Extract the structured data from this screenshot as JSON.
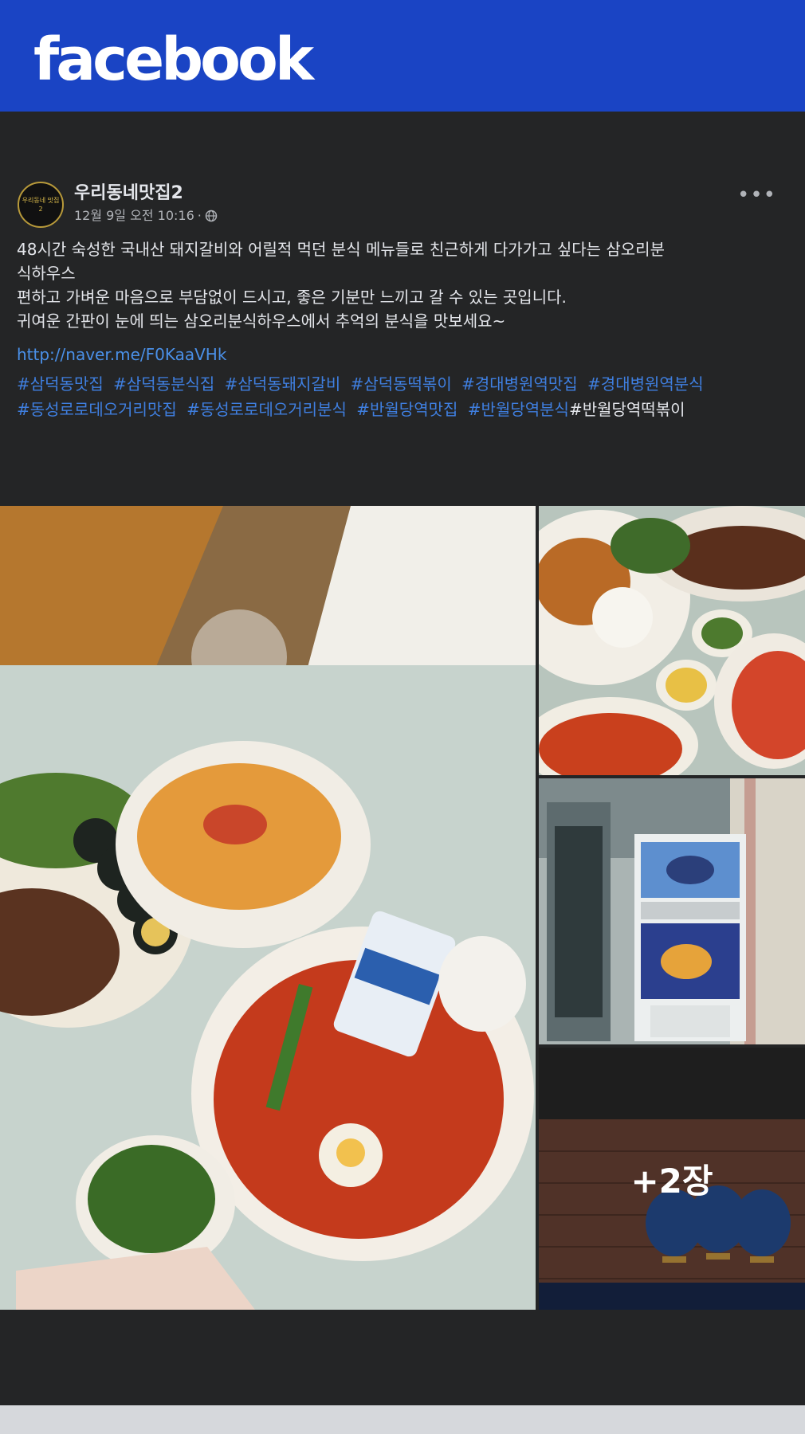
{
  "app": {
    "logo_text": "facebook",
    "brand_color": "#1a44c4"
  },
  "post": {
    "avatar_text": "우리동네 맛집 2",
    "page_name": "우리동네맛집2",
    "timestamp": "12월 9일 오전 10:16",
    "separator": "·",
    "privacy_icon": "globe-icon",
    "more_label": "•••",
    "body_lines": [
      "48시간 숙성한 국내산 돼지갈비와 어릴적 먹던 분식 메뉴들로 친근하게 다가가고 싶다는 삼오리분",
      "식하우스",
      "편하고 가벼운 마음으로 부담없이 드시고, 좋은 기분만 느끼고 갈 수 있는 곳입니다.",
      "귀여운 간판이 눈에 띄는 삼오리분식하우스에서 추억의 분식을 맛보세요~"
    ],
    "link": "http://naver.me/F0KaaVHk",
    "hashtags_row1": [
      "#삼덕동맛집",
      "#삼덕동분식집",
      "#삼덕동돼지갈비",
      "#삼덕동떡볶이",
      "#경대병원역맛집",
      "#경대병원역분식"
    ],
    "hashtags_row2": [
      "#동성로로데오거리맛집",
      "#동성로로데오거리분식",
      "#반월당역맛집",
      "#반월당역분식"
    ],
    "hashtag_plain": "#반월당역떡볶이",
    "photos": {
      "more_count_label": "+2장",
      "main_description": "food-table-photo",
      "side1_description": "plated-meal-photo",
      "side2_description": "storefront-vending-photo",
      "side3_description": "signboard-photo"
    }
  }
}
